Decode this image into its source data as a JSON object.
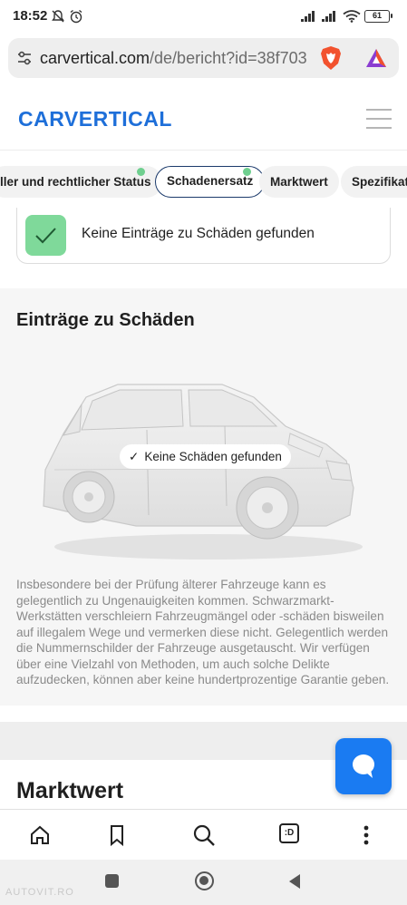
{
  "status_bar": {
    "time": "18:52",
    "battery": "61"
  },
  "browser": {
    "url_domain": "carvertical.com",
    "url_path": "/de/bericht?id=38f703"
  },
  "header": {
    "logo_text": "CARVERTICAL",
    "brand_color": "#1e6fd9"
  },
  "tabs": [
    {
      "label": "ller und rechtlicher Status",
      "has_dot": true
    },
    {
      "label": "Schadenersatz",
      "has_dot": true,
      "active": true
    },
    {
      "label": "Marktwert",
      "has_dot": false
    },
    {
      "label": "Spezifikati",
      "has_dot": false
    }
  ],
  "result_card": {
    "text": "Keine Einträge zu Schäden gefunden",
    "icon": "check-icon",
    "status_color": "#7fd99a"
  },
  "damage_section": {
    "title": "Einträge zu Schäden",
    "car_badge": "Keine Schäden gefunden",
    "disclaimer": "Insbesondere bei der Prüfung älterer Fahrzeuge kann es gelegentlich zu Ungenauigkeiten kommen. Schwarzmarkt-Werkstätten verschleiern Fahrzeugmängel oder -schäden bisweilen auf illegalem Wege und vermerken diese nicht. Gelegentlich werden die Nummernschilder der Fahrzeuge ausgetauscht. Wir verfügen über eine Vielzahl von Methoden, um auch solche Delikte aufzudecken, können aber keine hundertprozentige Garantie geben."
  },
  "market_section": {
    "title": "Marktwert"
  },
  "chat_button": {
    "icon": "chat-bubble-icon",
    "color": "#1a7bf2"
  },
  "browser_nav": {
    "tab_switcher_label": ":D"
  },
  "watermark": "AUTOVIT.RO"
}
